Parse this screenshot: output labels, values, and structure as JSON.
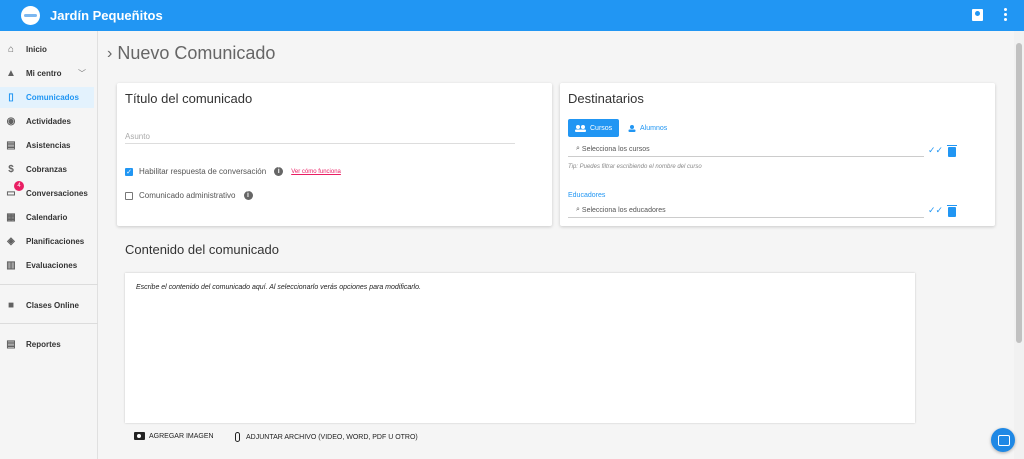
{
  "app": {
    "title": "Jardín Pequeñitos"
  },
  "sidebar": {
    "items": [
      {
        "label": "Inicio",
        "icon": "home-icon"
      },
      {
        "label": "Mi centro",
        "icon": "school-icon"
      },
      {
        "label": "Comunicados",
        "icon": "phone-icon"
      },
      {
        "label": "Actividades",
        "icon": "eye-icon"
      },
      {
        "label": "Asistencias",
        "icon": "clipboard-icon"
      },
      {
        "label": "Cobranzas",
        "icon": "dollar-icon"
      },
      {
        "label": "Conversaciones",
        "icon": "chat-icon",
        "badge": "4"
      },
      {
        "label": "Calendario",
        "icon": "calendar-icon"
      },
      {
        "label": "Planificaciones",
        "icon": "compass-icon"
      },
      {
        "label": "Evaluaciones",
        "icon": "chart-icon"
      },
      {
        "label": "Clases Online",
        "icon": "video-icon"
      },
      {
        "label": "Reportes",
        "icon": "document-icon"
      }
    ],
    "active": "Comunicados"
  },
  "page": {
    "title": "Nuevo Comunicado"
  },
  "titulo_card": {
    "heading": "Título del comunicado",
    "subject_placeholder": "Asunto",
    "reply_label": "Habilitar respuesta de conversación",
    "reply_checked": true,
    "how_link": "Ver cómo funciona",
    "admin_label": "Comunicado administrativo",
    "admin_checked": false
  },
  "destinatarios": {
    "heading": "Destinatarios",
    "tab_cursos": "Cursos",
    "tab_alumnos": "Alumnos",
    "cursos_placeholder": "Selecciona los cursos",
    "tip": "Tip: Puedes filtrar escribiendo el nombre del curso",
    "educadores_label": "Educadores",
    "educadores_placeholder": "Selecciona los educadores"
  },
  "contenido": {
    "heading": "Contenido del comunicado",
    "editor_placeholder": "Escribe el contenido del comunicado aquí. Al seleccionarlo verás opciones para modificarlo.",
    "add_image": "AGREGAR IMAGEN",
    "attach_file": "ADJUNTAR ARCHIVO (VIDEO, WORD, PDF U OTRO)"
  },
  "colors": {
    "primary": "#2196f3",
    "accent": "#e91e63"
  }
}
